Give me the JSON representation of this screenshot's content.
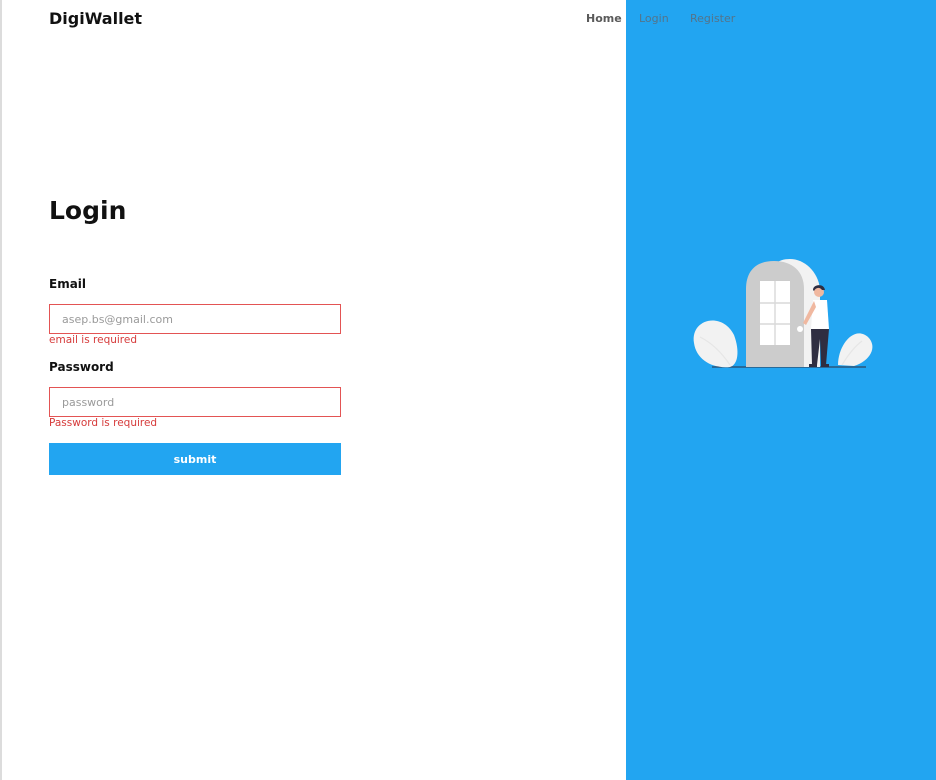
{
  "brand": {
    "name": "DigiWallet"
  },
  "nav": {
    "items": [
      "Home",
      "Login",
      "Register"
    ]
  },
  "login": {
    "title": "Login",
    "email": {
      "label": "Email",
      "placeholder": "asep.bs@gmail.com",
      "value": "",
      "error": "email is required"
    },
    "password": {
      "label": "Password",
      "placeholder": "password",
      "value": "",
      "error": "Password is required"
    },
    "submit_label": "submit"
  },
  "colors": {
    "accent": "#22a5f1",
    "error": "#d63b3b",
    "error_border": "#e35454",
    "text": "#111111"
  },
  "illustration": {
    "name": "door-person-illustration"
  }
}
